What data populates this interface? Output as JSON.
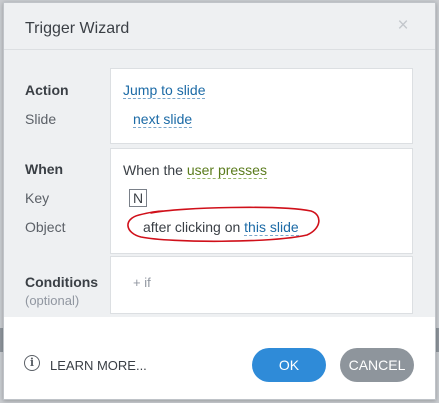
{
  "dialog": {
    "title": "Trigger Wizard",
    "close_symbol": "×"
  },
  "action_section": {
    "action_label": "Action",
    "slide_label": "Slide",
    "action_value": "Jump to slide",
    "slide_value": "next slide"
  },
  "when_section": {
    "when_label": "When",
    "key_label": "Key",
    "object_label": "Object",
    "when_prefix": "When the",
    "when_value": "user presses",
    "key_value": "N",
    "object_prefix": "after clicking on",
    "object_value": "this slide",
    "annotation_color": "#d0101a"
  },
  "conditions_section": {
    "label": "Conditions",
    "sublabel": "(optional)",
    "add_if": "+ if"
  },
  "footer": {
    "learn_more": "LEARN MORE...",
    "info_symbol": "i",
    "ok_label": "OK",
    "cancel_label": "CANCEL"
  },
  "colors": {
    "ok_button": "#2f8bd8",
    "cancel_button": "#8e959c",
    "link_blue": "#1b6aa6",
    "link_green": "#5a7b1c"
  }
}
